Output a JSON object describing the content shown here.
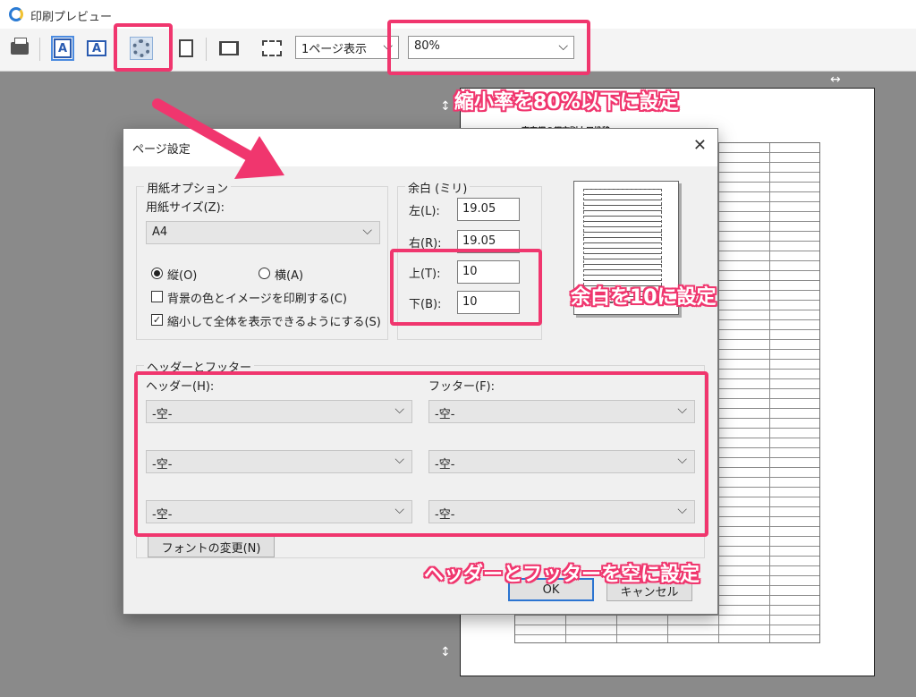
{
  "window": {
    "title": "印刷プレビュー"
  },
  "toolbar": {
    "page_view": "1ページ表示",
    "zoom": "80%",
    "icons": [
      "printer-icon",
      "portrait-icon",
      "landscape-icon",
      "page-setup-gear-icon",
      "page-icon",
      "fit-width-icon",
      "full-page-icon"
    ]
  },
  "preview": {
    "doc_title": "東京都の都市別人口推移"
  },
  "dialog": {
    "title": "ページ設定",
    "paper": {
      "legend": "用紙オプション",
      "size_label": "用紙サイズ(Z):",
      "size_value": "A4",
      "portrait_label": "縦(O)",
      "landscape_label": "横(A)",
      "orientation": "portrait",
      "print_bg_label": "背景の色とイメージを印刷する(C)",
      "print_bg_checked": false,
      "shrink_label": "縮小して全体を表示できるようにする(S)",
      "shrink_checked": true
    },
    "margins": {
      "legend": "余白 (ミリ)",
      "left_label": "左(L):",
      "left_value": "19.05",
      "right_label": "右(R):",
      "right_value": "19.05",
      "top_label": "上(T):",
      "top_value": "10",
      "bottom_label": "下(B):",
      "bottom_value": "10"
    },
    "header_footer": {
      "legend": "ヘッダーとフッター",
      "header_label": "ヘッダー(H):",
      "footer_label": "フッター(F):",
      "header_values": [
        "-空-",
        "-空-",
        "-空-"
      ],
      "footer_values": [
        "-空-",
        "-空-",
        "-空-"
      ],
      "font_button": "フォントの変更(N)"
    },
    "ok_label": "OK",
    "cancel_label": "キャンセル"
  },
  "annotations": {
    "zoom_note": "縮小率を80%以下に設定",
    "margin_note": "余白を10に設定",
    "header_footer_note": "ヘッダーとフッターを空に設定",
    "accent_color": "#f0366e"
  }
}
